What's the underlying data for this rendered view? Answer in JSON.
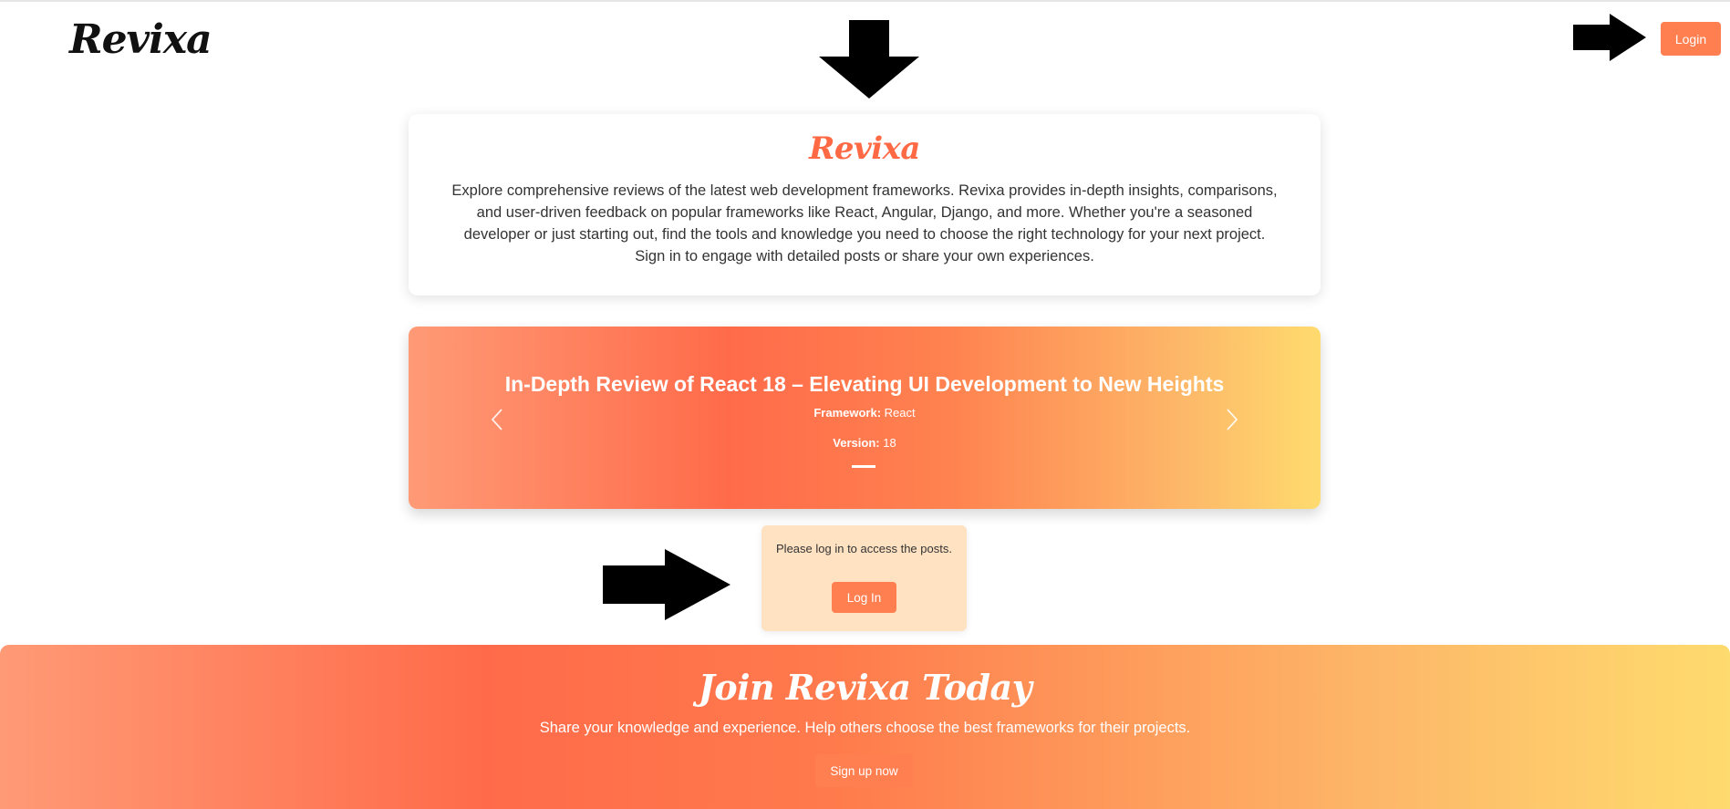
{
  "header": {
    "brand": "Revixa",
    "login_label": "Login"
  },
  "intro": {
    "title": "Revixa",
    "text": "Explore comprehensive reviews of the latest web development frameworks. Revixa provides in-depth insights, comparisons, and user-driven feedback on popular frameworks like React, Angular, Django, and more. Whether you're a seasoned developer or just starting out, find the tools and knowledge you need to choose the right technology for your next project. Sign in to engage with detailed posts or share your own experiences."
  },
  "carousel": {
    "title": "In-Depth Review of React 18 – Elevating UI Development to New Heights",
    "framework_label": "Framework:",
    "framework_value": "React",
    "version_label": "Version:",
    "version_value": "18",
    "prev_icon": "chevron-left-icon",
    "next_icon": "chevron-right-icon"
  },
  "notice": {
    "text": "Please log in to access the posts.",
    "button_label": "Log In"
  },
  "join": {
    "title": "Join Revixa Today",
    "subtitle": "Share your knowledge and experience. Help others choose the best frameworks for their projects.",
    "button_label": "Sign up now"
  },
  "colors": {
    "accent": "#ff7f50",
    "brand_text": "#ff6a45",
    "notice_bg": "#ffe2c2",
    "gradient_start": "#ff9a76",
    "gradient_mid": "#ff6b4a",
    "gradient_end": "#fedb6e"
  }
}
